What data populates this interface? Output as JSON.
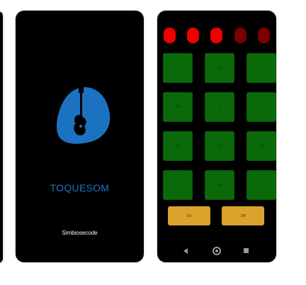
{
  "splash": {
    "app_name": "TOQUESOM",
    "developer": "Simbiosecode"
  },
  "pads": {
    "leds": [
      "on",
      "on",
      "on",
      "off",
      "off"
    ],
    "items": [
      "C",
      "C#",
      "D",
      "D#",
      "E",
      "F",
      "F#",
      "G",
      "G#",
      "A",
      "A#",
      "B"
    ],
    "on_label": "On",
    "off_label": "Off"
  },
  "colors": {
    "logo_blue": "#1b72c0",
    "led_on": "#ee0000",
    "led_off": "#7a0000",
    "pad_green": "#0a6a0a",
    "control_yellow": "#d9a32c"
  },
  "icons": {
    "logo": "guitar-pick-icon",
    "nav": [
      "back-icon",
      "home-icon",
      "recents-icon"
    ]
  }
}
